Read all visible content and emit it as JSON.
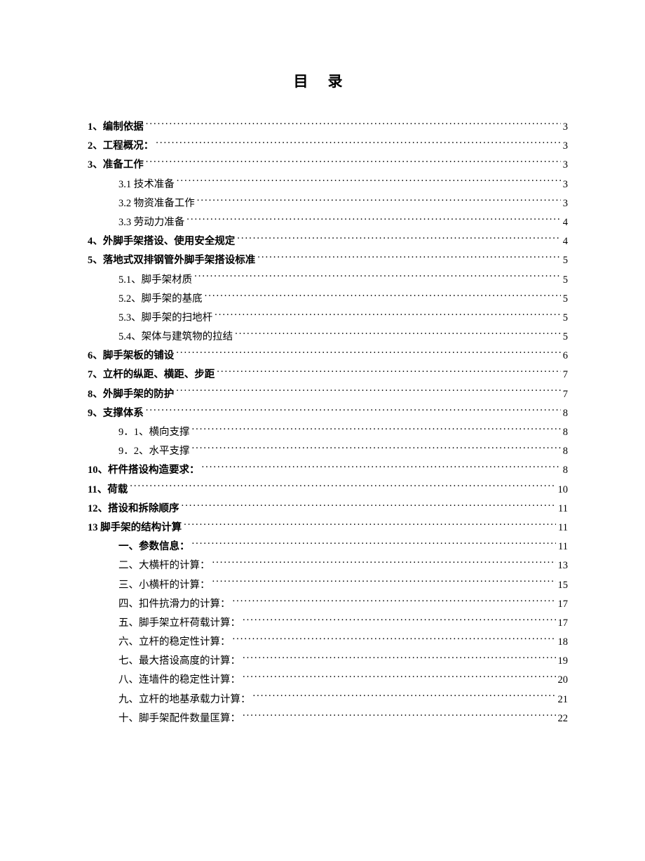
{
  "title": "目录",
  "toc": [
    {
      "level": 0,
      "bold": true,
      "label": "1、编制依据",
      "page": "3"
    },
    {
      "level": 0,
      "bold": true,
      "label": "2、工程概况：",
      "page": "3"
    },
    {
      "level": 0,
      "bold": true,
      "label": "3、准备工作",
      "page": "3"
    },
    {
      "level": 1,
      "bold": false,
      "label": "3.1 技术准备",
      "page": "3"
    },
    {
      "level": 1,
      "bold": false,
      "label": "3.2 物资准备工作",
      "page": "3"
    },
    {
      "level": 1,
      "bold": false,
      "label": "3.3 劳动力准备",
      "page": "4"
    },
    {
      "level": 0,
      "bold": true,
      "label": "4、外脚手架搭设、使用安全规定",
      "page": "4"
    },
    {
      "level": 0,
      "bold": true,
      "label": "5、落地式双排钢管外脚手架搭设标准",
      "page": "5"
    },
    {
      "level": 1,
      "bold": false,
      "label": "5.1、脚手架材质",
      "page": "5"
    },
    {
      "level": 1,
      "bold": false,
      "label": "5.2、脚手架的基底",
      "page": "5"
    },
    {
      "level": 1,
      "bold": false,
      "label": "5.3、脚手架的扫地杆",
      "page": "5"
    },
    {
      "level": 1,
      "bold": false,
      "label": "5.4、架体与建筑物的拉结",
      "page": "5"
    },
    {
      "level": 0,
      "bold": true,
      "label": "6、脚手架板的铺设",
      "page": "6"
    },
    {
      "level": 0,
      "bold": true,
      "label": "7、立杆的纵距、横距、步距",
      "page": "7"
    },
    {
      "level": 0,
      "bold": true,
      "label": "8、外脚手架的防护",
      "page": "7"
    },
    {
      "level": 0,
      "bold": true,
      "label": "9、支撑体系",
      "page": "8"
    },
    {
      "level": 1,
      "bold": false,
      "label": "9．1、横向支撑",
      "page": "8"
    },
    {
      "level": 1,
      "bold": false,
      "label": "9．2、水平支撑",
      "page": "8"
    },
    {
      "level": 0,
      "bold": true,
      "label": "10、杆件搭设构造要求：",
      "page": "8"
    },
    {
      "level": 0,
      "bold": true,
      "label": "11、荷载",
      "page": "10"
    },
    {
      "level": 0,
      "bold": true,
      "label": "12、搭设和拆除顺序",
      "page": "11"
    },
    {
      "level": 0,
      "bold": true,
      "label": "13 脚手架的结构计算",
      "page": "11"
    },
    {
      "level": 1,
      "bold": true,
      "label": "一、参数信息：",
      "page": "11"
    },
    {
      "level": 1,
      "bold": false,
      "label": "二、大横杆的计算：",
      "page": "13"
    },
    {
      "level": 1,
      "bold": false,
      "label": "三、小横杆的计算：",
      "page": "15"
    },
    {
      "level": 1,
      "bold": false,
      "label": "四、扣件抗滑力的计算：",
      "page": "17"
    },
    {
      "level": 1,
      "bold": false,
      "label": "五、脚手架立杆荷载计算：",
      "page": "17"
    },
    {
      "level": 1,
      "bold": false,
      "label": "六、立杆的稳定性计算：",
      "page": "18"
    },
    {
      "level": 1,
      "bold": false,
      "label": "七、最大搭设高度的计算：",
      "page": "19"
    },
    {
      "level": 1,
      "bold": false,
      "label": "八、连墙件的稳定性计算：",
      "page": "20"
    },
    {
      "level": 1,
      "bold": false,
      "label": "九、立杆的地基承载力计算：",
      "page": "21"
    },
    {
      "level": 1,
      "bold": false,
      "label": "十、脚手架配件数量匡算：",
      "page": "22"
    }
  ]
}
